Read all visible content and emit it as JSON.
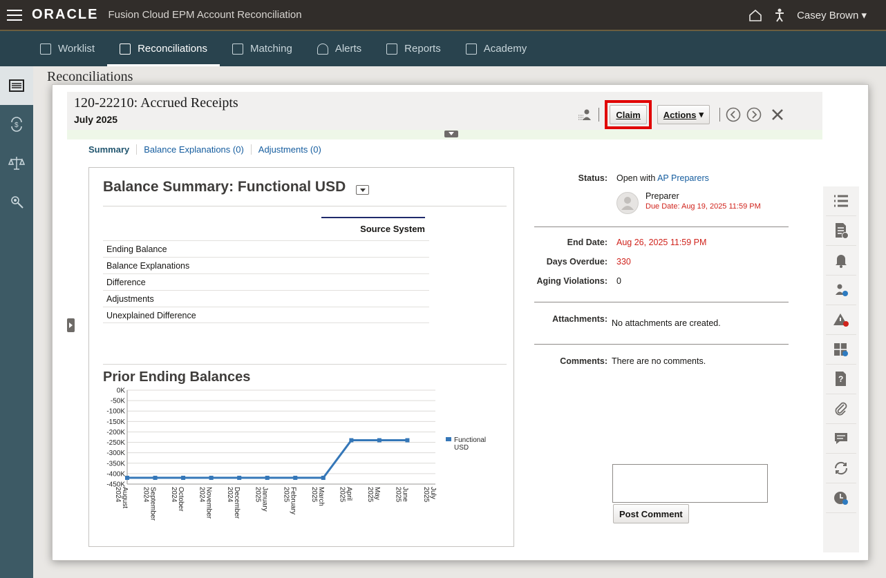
{
  "header": {
    "logo": "ORACLE",
    "app_title": "Fusion Cloud EPM Account Reconciliation",
    "user": "Casey Brown"
  },
  "nav": {
    "tabs": [
      {
        "label": "Worklist",
        "icon": "clipboard-icon"
      },
      {
        "label": "Reconciliations",
        "icon": "list-icon"
      },
      {
        "label": "Matching",
        "icon": "matching-icon"
      },
      {
        "label": "Alerts",
        "icon": "bell-icon"
      },
      {
        "label": "Reports",
        "icon": "report-icon"
      },
      {
        "label": "Academy",
        "icon": "video-icon"
      }
    ]
  },
  "page": {
    "title": "Reconciliations"
  },
  "modal": {
    "title": "120-22210: Accrued Receipts",
    "subtitle": "July 2025",
    "claim_label": "Claim",
    "actions_label": "Actions",
    "tabs": [
      "Summary",
      "Balance Explanations (0)",
      "Adjustments (0)"
    ]
  },
  "balance_summary": {
    "title": "Balance Summary: Functional USD",
    "column": "Source System",
    "rows": [
      "Ending Balance",
      "Balance Explanations",
      "Difference",
      "Adjustments",
      "Unexplained Difference"
    ]
  },
  "prior": {
    "title": "Prior Ending Balances"
  },
  "chart_data": {
    "type": "line",
    "title": "Prior Ending Balances",
    "x": [
      "August 2024",
      "September 2024",
      "October 2024",
      "November 2024",
      "December 2024",
      "January 2025",
      "February 2025",
      "March 2025",
      "April 2025",
      "May 2025",
      "June 2025",
      "July 2025"
    ],
    "series": [
      {
        "name": "Functional USD",
        "values": [
          -420000,
          -420000,
          -420000,
          -420000,
          -420000,
          -420000,
          -420000,
          -420000,
          -240000,
          -240000,
          -240000,
          null
        ]
      }
    ],
    "yticks": [
      "0K",
      "-50K",
      "-100K",
      "-150K",
      "-200K",
      "-250K",
      "-300K",
      "-350K",
      "-400K",
      "-450K"
    ],
    "ylim": [
      -450000,
      0
    ],
    "legend": "right",
    "color": "#3577b8"
  },
  "info": {
    "status_label": "Status:",
    "status_prefix": "Open with",
    "status_link": "AP Preparers",
    "preparer_role": "Preparer",
    "due_date": "Due Date:  Aug 19, 2025 11:59 PM",
    "end_date_label": "End Date:",
    "end_date": "Aug 26, 2025 11:59 PM",
    "days_overdue_label": "Days Overdue:",
    "days_overdue": "330",
    "aging_label": "Aging Violations:",
    "aging": "0",
    "attachments_label": "Attachments:",
    "attachments": "No attachments are created.",
    "comments_label": "Comments:",
    "comments": "There are no comments.",
    "post_comment": "Post Comment"
  },
  "right_rail": [
    "list-icon",
    "info-doc-icon",
    "alert-bell-icon",
    "users-icon",
    "warning-icon",
    "workflow-icon",
    "question-icon",
    "attachment-icon",
    "comment-icon",
    "history-icon",
    "clock-icon"
  ]
}
